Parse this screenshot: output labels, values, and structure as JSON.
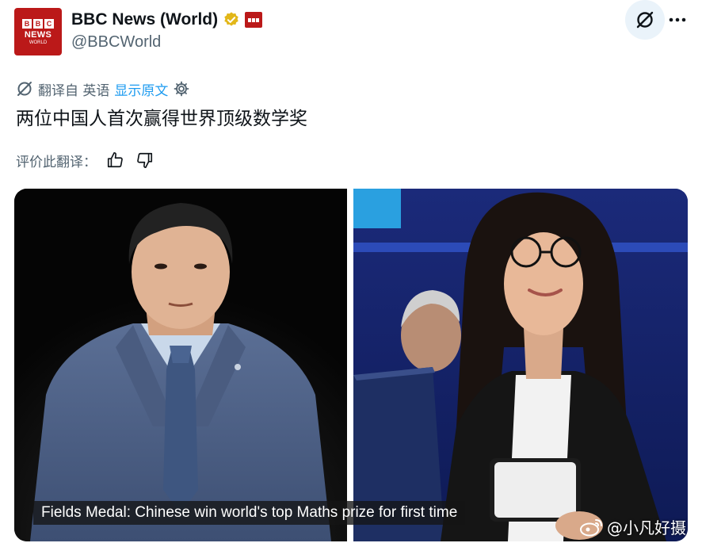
{
  "header": {
    "avatar": {
      "blocks": [
        "B",
        "B",
        "C"
      ],
      "line1": "NEWS",
      "line2": "WORLD"
    },
    "display_name": "BBC News (World)",
    "handle": "@BBCWorld"
  },
  "translation": {
    "translated_from": "翻译自 英语",
    "show_original": "显示原文"
  },
  "tweet": {
    "text": "两位中国人首次赢得世界顶级数学奖"
  },
  "rating": {
    "label": "评价此翻译："
  },
  "media": {
    "caption": "Fields Medal: Chinese win world's top Maths prize for first time",
    "watermark": "@小凡好摄"
  },
  "colors": {
    "brand_red": "#bb1919",
    "link_blue": "#1d9bf0",
    "muted": "#536471",
    "grok_bg": "#eaf3fa"
  },
  "icons": [
    "verified-badge-icon",
    "grok-icon",
    "more-icon",
    "translate-icon",
    "gear-icon",
    "thumbs-up-icon",
    "thumbs-down-icon",
    "weibo-icon"
  ]
}
